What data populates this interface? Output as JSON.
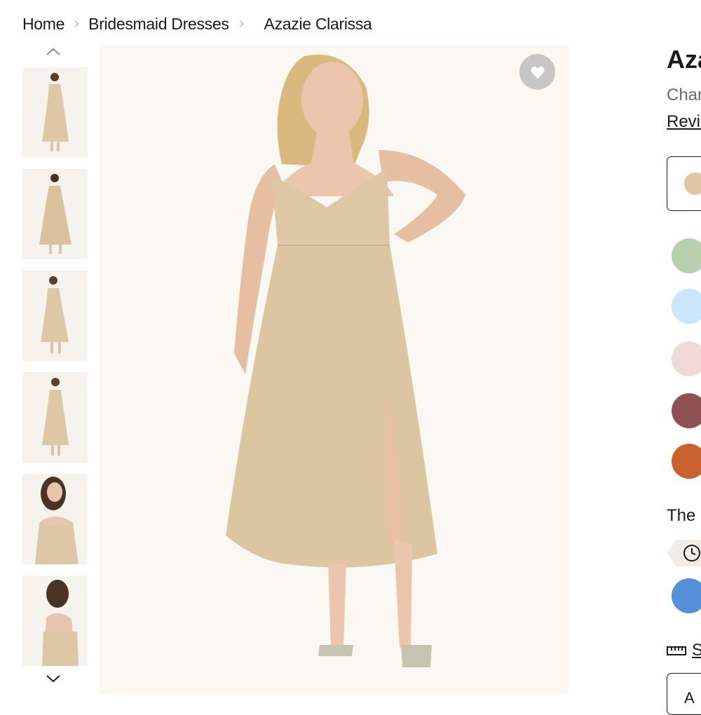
{
  "breadcrumb": {
    "home": "Home",
    "category": "Bridesmaid Dresses",
    "current": "Azazie Clarissa"
  },
  "product": {
    "title": "Aza",
    "subtitle": "Char",
    "reviews_label": "Revie"
  },
  "gallery": {
    "thumb_count": 6,
    "scroll_up_icon": "chevron-up-icon",
    "scroll_down_icon": "chevron-down-icon",
    "favorite_icon": "heart-icon"
  },
  "colors": {
    "dress": "#ddc7a4",
    "selected": "#e0c6a4",
    "swatches": [
      "#b8cfae",
      "#c9e6fb",
      "#f0d9d8",
      "#8e5050",
      "#c9622f",
      "#5590d8"
    ]
  },
  "shipping": {
    "info_text": "The c",
    "clock_icon": "clock-icon"
  },
  "size": {
    "ruler_icon": "ruler-icon",
    "link_text": "S",
    "button_text": "A"
  }
}
